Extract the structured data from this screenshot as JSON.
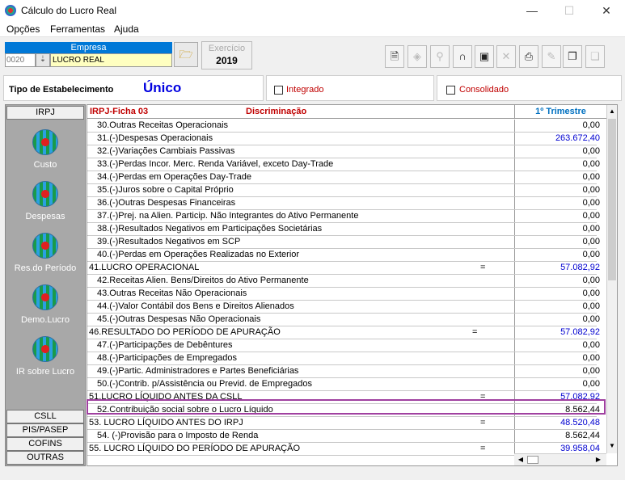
{
  "window": {
    "title": "Cálculo do Lucro Real",
    "minimize": "—",
    "maximize": "☐",
    "close": "✕"
  },
  "menu": [
    "Opções",
    "Ferramentas",
    "Ajuda"
  ],
  "empresa": {
    "header": "Empresa",
    "code": "0020",
    "name": "LUCRO REAL",
    "spin_icon": "spin-down-icon"
  },
  "exercicio": {
    "label": "Exercício",
    "year": "2019"
  },
  "toolbar": [
    {
      "icon": "document-icon",
      "glyph": "🗎",
      "enabled": true
    },
    {
      "icon": "diamond-icon",
      "glyph": "◈",
      "enabled": false
    },
    {
      "icon": "search-person-icon",
      "glyph": "⚲",
      "enabled": false
    },
    {
      "icon": "padlock-icon",
      "glyph": "∩",
      "enabled": true
    },
    {
      "icon": "save-icon",
      "glyph": "▣",
      "enabled": true
    },
    {
      "icon": "delete-icon",
      "glyph": "✕",
      "enabled": false
    },
    {
      "icon": "print-icon",
      "glyph": "⎙",
      "enabled": true
    },
    {
      "icon": "tool-icon",
      "glyph": "✎",
      "enabled": false
    },
    {
      "icon": "multi-document-icon",
      "glyph": "❐",
      "enabled": true
    },
    {
      "icon": "window-icon",
      "glyph": "❏",
      "enabled": false
    }
  ],
  "tipo": {
    "label": "Tipo de Estabelecimento",
    "value": "Único"
  },
  "checkboxes": {
    "integrado": "Integrado",
    "consolidado": "Consolidado"
  },
  "nav": {
    "top_tab": "IRPJ",
    "items": [
      "Custo",
      "Despesas",
      "Res.do Período",
      "Demo.Lucro",
      "IR sobre Lucro"
    ],
    "bottom_tabs": [
      "CSLL",
      "PIS/PASEP",
      "COFINS",
      "OUTRAS"
    ]
  },
  "grid": {
    "col_ficha": "IRPJ-Ficha  03",
    "col_desc": "Discriminação",
    "col_value": "1º Trimestre",
    "rows": [
      {
        "desc": "30.Outras Receitas Operacionais",
        "indent": true,
        "eq": "",
        "value": "0,00",
        "total": false
      },
      {
        "desc": "31.(-)Despesas Operacionais",
        "indent": true,
        "eq": "",
        "value": "263.672,40",
        "total": true
      },
      {
        "desc": "32.(-)Variações Cambiais Passivas",
        "indent": true,
        "eq": "",
        "value": "0,00",
        "total": false
      },
      {
        "desc": "33.(-)Perdas Incor. Merc. Renda Variável, exceto Day-Trade",
        "indent": true,
        "eq": "",
        "value": "0,00",
        "total": false
      },
      {
        "desc": "34.(-)Perdas em Operações Day-Trade",
        "indent": true,
        "eq": "",
        "value": "0,00",
        "total": false
      },
      {
        "desc": "35.(-)Juros sobre o Capital Próprio",
        "indent": true,
        "eq": "",
        "value": "0,00",
        "total": false
      },
      {
        "desc": "36.(-)Outras Despesas Financeiras",
        "indent": true,
        "eq": "",
        "value": "0,00",
        "total": false
      },
      {
        "desc": "37.(-)Prej. na Alien. Particip. Não Integrantes do Ativo Permanente",
        "indent": true,
        "eq": "",
        "value": "0,00",
        "total": false
      },
      {
        "desc": "38.(-)Resultados Negativos em Participações Societárias",
        "indent": true,
        "eq": "",
        "value": "0,00",
        "total": false
      },
      {
        "desc": "39.(-)Resultados Negativos em SCP",
        "indent": true,
        "eq": "",
        "value": "0,00",
        "total": false
      },
      {
        "desc": "40.(-)Perdas em Operações Realizadas no Exterior",
        "indent": true,
        "eq": "",
        "value": "0,00",
        "total": false
      },
      {
        "desc": "41.LUCRO OPERACIONAL",
        "indent": false,
        "eq": "=",
        "value": "57.082,92",
        "total": true
      },
      {
        "desc": "42.Receitas Alien. Bens/Direitos do Ativo Permanente",
        "indent": true,
        "eq": "",
        "value": "0,00",
        "total": false
      },
      {
        "desc": "43.Outras Receitas Não Operacionais",
        "indent": true,
        "eq": "",
        "value": "0,00",
        "total": false
      },
      {
        "desc": "44.(-)Valor Contábil dos Bens e Direitos Alienados",
        "indent": true,
        "eq": "",
        "value": "0,00",
        "total": false
      },
      {
        "desc": "45.(-)Outras Despesas Não Operacionais",
        "indent": true,
        "eq": "",
        "value": "0,00",
        "total": false
      },
      {
        "desc": "46.RESULTADO DO PERÍODO DE APURAÇÃO",
        "indent": false,
        "eq": "=",
        "value": "57.082,92",
        "total": true
      },
      {
        "desc": "47.(-)Participações de Debêntures",
        "indent": true,
        "eq": "",
        "value": "0,00",
        "total": false
      },
      {
        "desc": "48.(-)Participações de Empregados",
        "indent": true,
        "eq": "",
        "value": "0,00",
        "total": false
      },
      {
        "desc": "49.(-)Partic. Administradores e Partes Beneficiárias",
        "indent": true,
        "eq": "",
        "value": "0,00",
        "total": false
      },
      {
        "desc": "50.(-)Contrib. p/Assistência ou Previd. de Empregados",
        "indent": true,
        "eq": "",
        "value": "0,00",
        "total": false
      },
      {
        "desc": "51.LUCRO LÍQUIDO ANTES DA CSLL",
        "indent": false,
        "eq": "=",
        "value": "57.082,92",
        "total": true
      },
      {
        "desc": "52.Contribuição social sobre o Lucro Líquido",
        "indent": true,
        "eq": "",
        "value": "8.562,44",
        "total": false
      },
      {
        "desc": "53. LUCRO LÍQUIDO ANTES DO IRPJ",
        "indent": false,
        "eq": "=",
        "value": "48.520,48",
        "total": true
      },
      {
        "desc": "54. (-)Provisão para o Imposto de Renda",
        "indent": true,
        "eq": "",
        "value": "8.562,44",
        "total": false
      },
      {
        "desc": "55. LUCRO LÍQUIDO DO PERÍODO DE APURAÇÃO",
        "indent": false,
        "eq": "=",
        "value": "39.958,04",
        "total": true
      }
    ]
  },
  "colors": {
    "accent": "#0078d7",
    "header_red": "#c00000",
    "value_blue": "#0000d0",
    "highlight": "#a040a0"
  }
}
